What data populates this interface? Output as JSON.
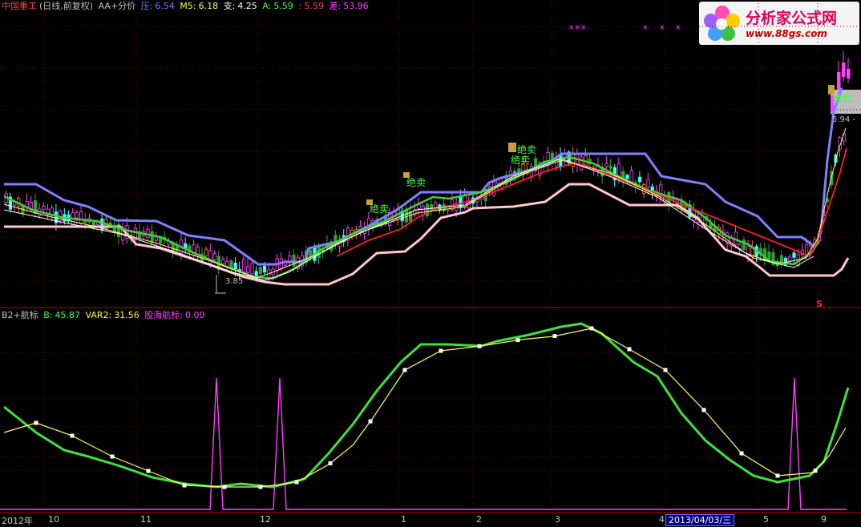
{
  "header": {
    "stock": "中国重工",
    "mode": "(日线,前复权)",
    "indicator": "AA+分价",
    "ya_label": "压:",
    "ya_value": "6.54",
    "m5_label": "M5:",
    "m5_value": "6.18",
    "zhi_label": "支:",
    "zhi_value": "4.25",
    "a_label": "A:",
    "a_value": "5.59",
    "blank_value": ": 5.59",
    "cha_label": "差:",
    "cha_value": "53.96"
  },
  "lower_header": {
    "name": "B2+航标",
    "b_label": "B:",
    "b_value": "45.87",
    "var2_label": "VAR2:",
    "var2_value": "31.56",
    "hb_label": "股海航标:",
    "hb_value": "0.00"
  },
  "logo": {
    "title": "分析家公式网",
    "url": "www.88gs.com"
  },
  "annotations": {
    "jue_mai": "绝卖",
    "price_label": "3.85",
    "right_price": "5.94 -",
    "s_mark": "S",
    "xxx": "×××",
    "x": "×"
  },
  "time_axis": {
    "labels": [
      "2012年",
      "10",
      "11",
      "12",
      "1",
      "2",
      "3",
      "4",
      "5",
      "9"
    ],
    "cursor_date": "2013/04/03/三"
  },
  "colors": {
    "ya": "#7a7aff",
    "m5": "#ffff40",
    "zhi": "#ffffff",
    "a": "#40ff40",
    "cha": "#ff40ff",
    "upper_band": "#8080ff",
    "lower_band": "#ffc8c8",
    "ma_green": "#40d040",
    "ma_red": "#ff2020",
    "candle_up": "#ff40ff",
    "candle_down": "#30a030",
    "b_line": "#40e040",
    "var2_line": "#ffff60",
    "spike": "#ff40ff"
  }
}
